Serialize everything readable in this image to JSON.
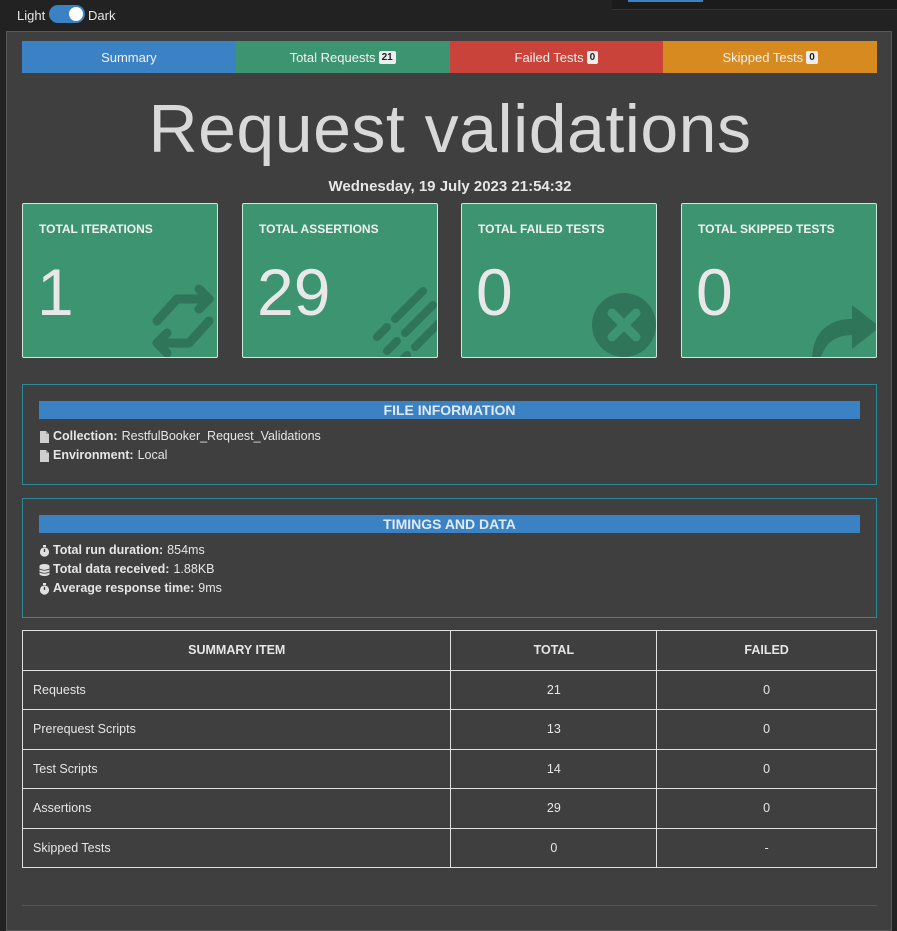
{
  "theme_toggle": {
    "light_label": "Light",
    "dark_label": "Dark"
  },
  "tabs": [
    {
      "label": "Summary"
    },
    {
      "label": "Total Requests",
      "badge": "21"
    },
    {
      "label": "Failed Tests",
      "badge": "0"
    },
    {
      "label": "Skipped Tests",
      "badge": "0"
    }
  ],
  "title": "Request validations",
  "date": "Wednesday, 19 July 2023 21:54:32",
  "cards": [
    {
      "label": "TOTAL ITERATIONS",
      "value": "1",
      "icon": "refresh-icon"
    },
    {
      "label": "TOTAL ASSERTIONS",
      "value": "29",
      "icon": "list-check-icon"
    },
    {
      "label": "TOTAL FAILED TESTS",
      "value": "0",
      "icon": "times-circle-icon"
    },
    {
      "label": "TOTAL SKIPPED TESTS",
      "value": "0",
      "icon": "share-arrow-icon"
    }
  ],
  "file_info": {
    "heading": "FILE INFORMATION",
    "collection_label": "Collection:",
    "collection_value": "RestfulBooker_Request_Validations",
    "environment_label": "Environment:",
    "environment_value": "Local"
  },
  "timings": {
    "heading": "TIMINGS AND DATA",
    "duration_label": "Total run duration:",
    "duration_value": "854ms",
    "data_label": "Total data received:",
    "data_value": "1.88KB",
    "avg_label": "Average response time:",
    "avg_value": "9ms"
  },
  "summary_table": {
    "headers": [
      "SUMMARY ITEM",
      "TOTAL",
      "FAILED"
    ],
    "rows": [
      [
        "Requests",
        "21",
        "0"
      ],
      [
        "Prerequest Scripts",
        "13",
        "0"
      ],
      [
        "Test Scripts",
        "14",
        "0"
      ],
      [
        "Assertions",
        "29",
        "0"
      ],
      [
        "Skipped Tests",
        "0",
        "-"
      ]
    ]
  },
  "colors": {
    "summary_tab": "#3b82c4",
    "total_tab": "#3d9470",
    "failed_tab": "#c9433a",
    "skipped_tab": "#d78a1f",
    "card_bg": "#3d9470"
  }
}
